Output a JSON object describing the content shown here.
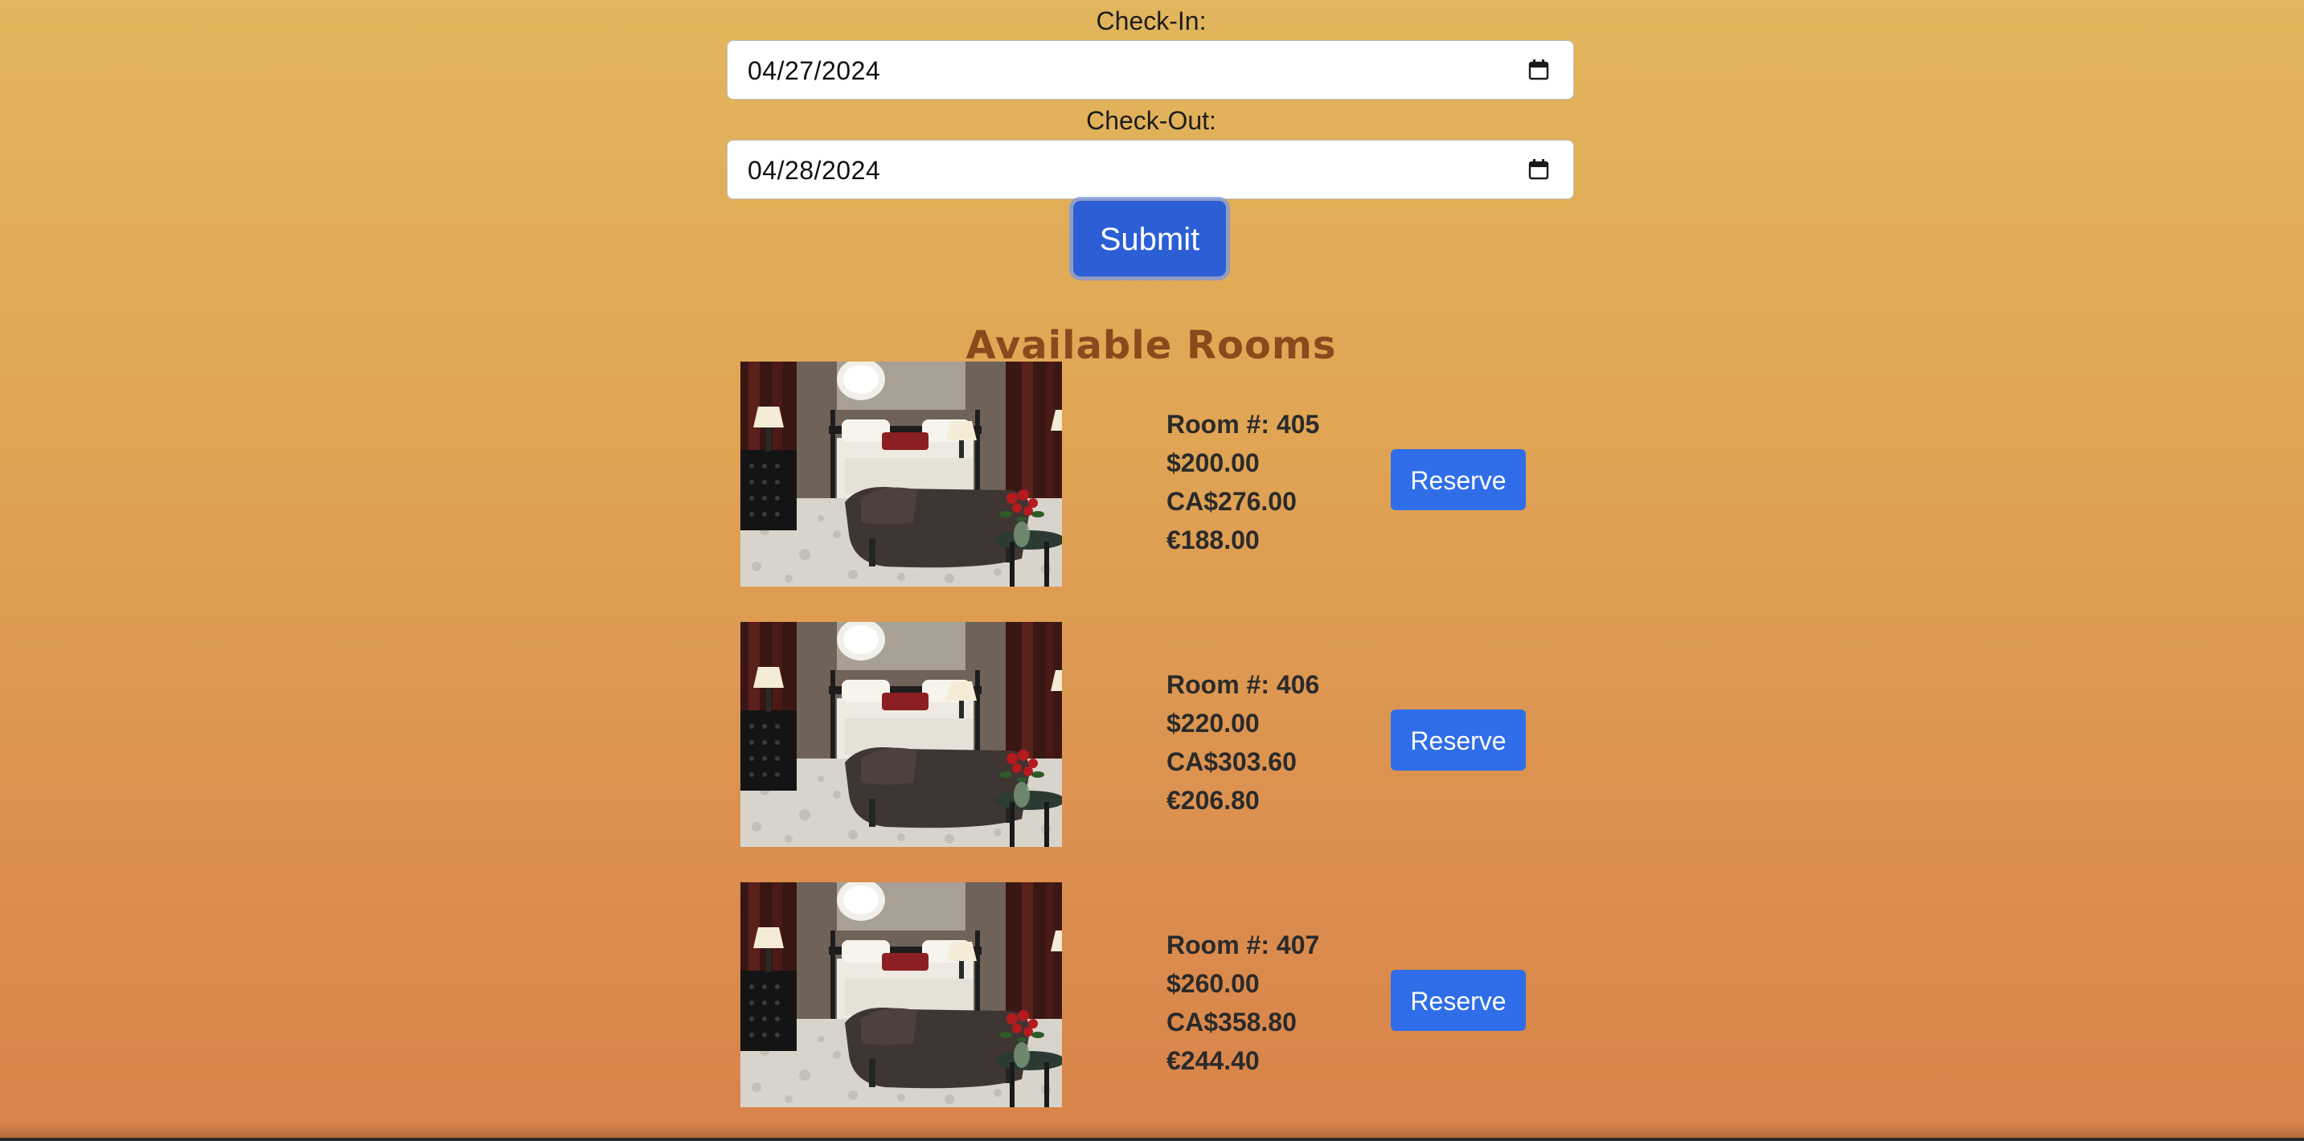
{
  "form": {
    "checkin_label": "Check-In:",
    "checkin_value": "04/27/2024",
    "checkout_label": "Check-Out:",
    "checkout_value": "04/28/2024",
    "submit_label": "Submit"
  },
  "section": {
    "title": "Available Rooms"
  },
  "rooms": [
    {
      "room_number": "Room #: 405",
      "usd": "$200.00",
      "cad": "CA$276.00",
      "eur": "€188.00",
      "reserve_label": "Reserve"
    },
    {
      "room_number": "Room #: 406",
      "usd": "$220.00",
      "cad": "CA$303.60",
      "eur": "€206.80",
      "reserve_label": "Reserve"
    },
    {
      "room_number": "Room #: 407",
      "usd": "$260.00",
      "cad": "CA$358.80",
      "eur": "€244.40",
      "reserve_label": "Reserve"
    }
  ],
  "colors": {
    "accent_button": "#2f6ee8",
    "submit_button": "#2c5fd6",
    "title": "#8a4a1c",
    "background_top": "#e2b65c",
    "background_bottom": "#d8834a"
  },
  "icons": {
    "date_picker": "calendar-icon"
  }
}
